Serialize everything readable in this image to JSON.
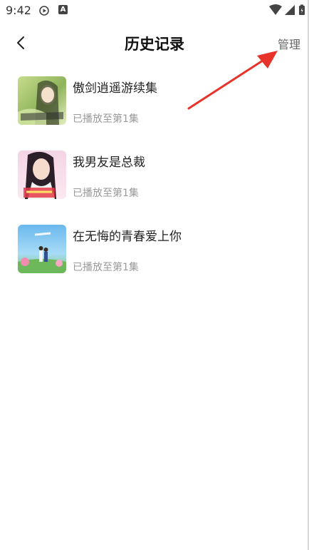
{
  "status_bar": {
    "time": "9:42",
    "icons": [
      "play-circle-icon",
      "a-icon",
      "wifi-icon",
      "signal-icon",
      "battery-icon"
    ]
  },
  "header": {
    "title": "历史记录",
    "manage_label": "管理",
    "back_icon": "chevron-left-icon"
  },
  "history": [
    {
      "title": "傲剑逍遥游续集",
      "progress": "已播放至第1集"
    },
    {
      "title": "我男友是总裁",
      "progress": "已播放至第1集"
    },
    {
      "title": "在无悔的青春爱上你",
      "progress": "已播放至第1集"
    }
  ],
  "colors": {
    "annotation_arrow": "#e8332a",
    "title": "#111111",
    "secondary_text": "#999999",
    "manage_text": "#666666"
  }
}
